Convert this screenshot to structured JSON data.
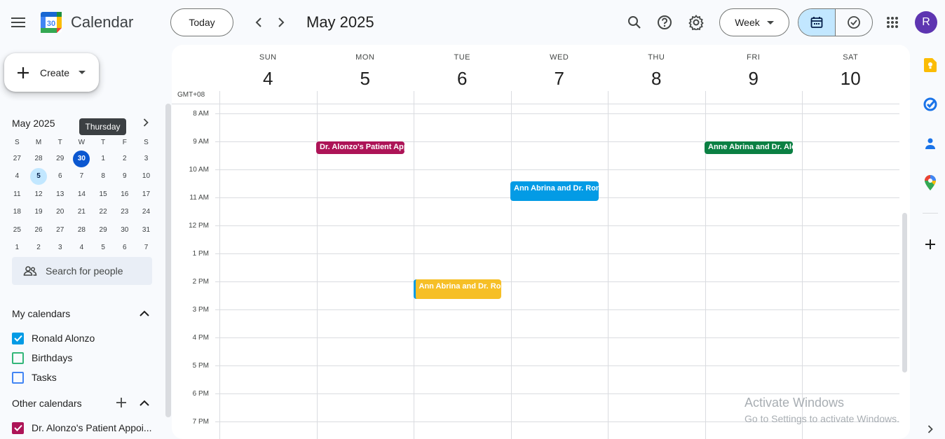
{
  "header": {
    "app_title": "Calendar",
    "logo_day": "30",
    "today_label": "Today",
    "month_title": "May 2025",
    "view_label": "Week",
    "avatar_letter": "R"
  },
  "sidebar": {
    "create_label": "Create",
    "mini_cal": {
      "title": "May 2025",
      "tooltip": "Thursday",
      "dow": [
        "S",
        "M",
        "T",
        "W",
        "T",
        "F",
        "S"
      ],
      "weeks": [
        [
          "27",
          "28",
          "29",
          "30",
          "1",
          "2",
          "3"
        ],
        [
          "4",
          "5",
          "6",
          "7",
          "8",
          "9",
          "10"
        ],
        [
          "11",
          "12",
          "13",
          "14",
          "15",
          "16",
          "17"
        ],
        [
          "18",
          "19",
          "20",
          "21",
          "22",
          "23",
          "24"
        ],
        [
          "25",
          "26",
          "27",
          "28",
          "29",
          "30",
          "31"
        ],
        [
          "1",
          "2",
          "3",
          "4",
          "5",
          "6",
          "7"
        ]
      ],
      "today": "30",
      "selected": "5"
    },
    "search_people_placeholder": "Search for people",
    "my_calendars": {
      "title": "My calendars",
      "items": [
        {
          "name": "Ronald Alonzo",
          "color": "#039be5",
          "checked": true
        },
        {
          "name": "Birthdays",
          "color": "#33b679",
          "checked": false
        },
        {
          "name": "Tasks",
          "color": "#4285f4",
          "checked": false
        }
      ]
    },
    "other_calendars": {
      "title": "Other calendars",
      "items": [
        {
          "name": "Dr. Alonzo's Patient Appoi...",
          "color": "#ad1457",
          "checked": true
        }
      ]
    }
  },
  "week": {
    "timezone": "GMT+08",
    "days": [
      {
        "dow": "SUN",
        "date": "4"
      },
      {
        "dow": "MON",
        "date": "5"
      },
      {
        "dow": "TUE",
        "date": "6"
      },
      {
        "dow": "WED",
        "date": "7"
      },
      {
        "dow": "THU",
        "date": "8"
      },
      {
        "dow": "FRI",
        "date": "9"
      },
      {
        "dow": "SAT",
        "date": "10"
      }
    ],
    "hours": [
      "8 AM",
      "9 AM",
      "10 AM",
      "11 AM",
      "12 PM",
      "1 PM",
      "2 PM",
      "3 PM",
      "4 PM",
      "5 PM",
      "6 PM",
      "7 PM"
    ],
    "events": [
      {
        "title": "Dr. Alonzo's Patient Appointment",
        "day": 1,
        "start": "9:00 AM",
        "color": "#ad1457"
      },
      {
        "title": "Anne Abrina and Dr. Alonzo",
        "day": 5,
        "start": "9:00 AM",
        "color": "#0b8043"
      },
      {
        "title": "Ann Abrina and Dr. Ronald",
        "day": 3,
        "start": "10:30 AM",
        "color": "#039be5"
      },
      {
        "title": "Ann Abrina and Dr. Ronald",
        "day": 2,
        "start": "2:00 PM",
        "color": "#f6bf26"
      }
    ]
  },
  "watermark": {
    "line1": "Activate Windows",
    "line2": "Go to Settings to activate Windows."
  },
  "side_panel": {
    "icons": [
      "keep-icon",
      "tasks-icon",
      "contacts-icon",
      "maps-icon",
      "add-icon"
    ]
  }
}
